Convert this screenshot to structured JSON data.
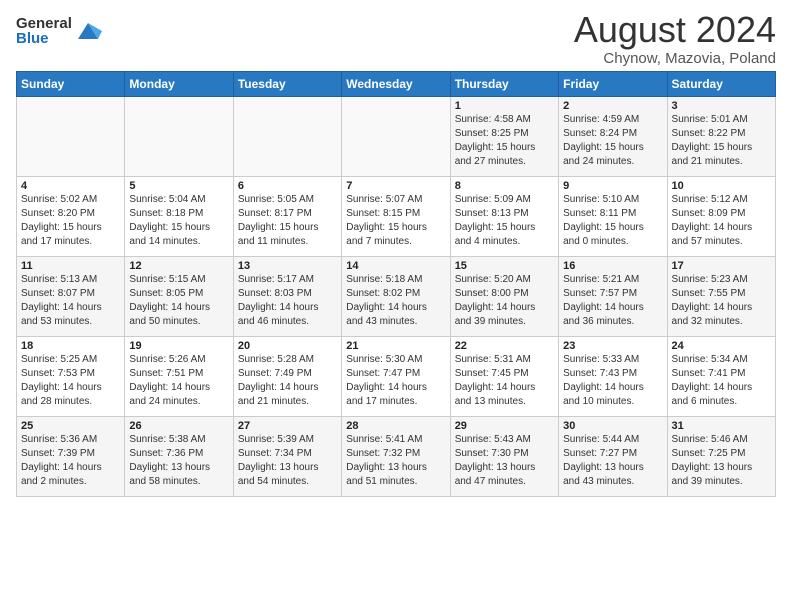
{
  "logo": {
    "general": "General",
    "blue": "Blue",
    "icon_color": "#2979c2"
  },
  "title": "August 2024",
  "location": "Chynow, Mazovia, Poland",
  "headers": [
    "Sunday",
    "Monday",
    "Tuesday",
    "Wednesday",
    "Thursday",
    "Friday",
    "Saturday"
  ],
  "rows": [
    [
      {
        "day": "",
        "info": ""
      },
      {
        "day": "",
        "info": ""
      },
      {
        "day": "",
        "info": ""
      },
      {
        "day": "",
        "info": ""
      },
      {
        "day": "1",
        "info": "Sunrise: 4:58 AM\nSunset: 8:25 PM\nDaylight: 15 hours\nand 27 minutes."
      },
      {
        "day": "2",
        "info": "Sunrise: 4:59 AM\nSunset: 8:24 PM\nDaylight: 15 hours\nand 24 minutes."
      },
      {
        "day": "3",
        "info": "Sunrise: 5:01 AM\nSunset: 8:22 PM\nDaylight: 15 hours\nand 21 minutes."
      }
    ],
    [
      {
        "day": "4",
        "info": "Sunrise: 5:02 AM\nSunset: 8:20 PM\nDaylight: 15 hours\nand 17 minutes."
      },
      {
        "day": "5",
        "info": "Sunrise: 5:04 AM\nSunset: 8:18 PM\nDaylight: 15 hours\nand 14 minutes."
      },
      {
        "day": "6",
        "info": "Sunrise: 5:05 AM\nSunset: 8:17 PM\nDaylight: 15 hours\nand 11 minutes."
      },
      {
        "day": "7",
        "info": "Sunrise: 5:07 AM\nSunset: 8:15 PM\nDaylight: 15 hours\nand 7 minutes."
      },
      {
        "day": "8",
        "info": "Sunrise: 5:09 AM\nSunset: 8:13 PM\nDaylight: 15 hours\nand 4 minutes."
      },
      {
        "day": "9",
        "info": "Sunrise: 5:10 AM\nSunset: 8:11 PM\nDaylight: 15 hours\nand 0 minutes."
      },
      {
        "day": "10",
        "info": "Sunrise: 5:12 AM\nSunset: 8:09 PM\nDaylight: 14 hours\nand 57 minutes."
      }
    ],
    [
      {
        "day": "11",
        "info": "Sunrise: 5:13 AM\nSunset: 8:07 PM\nDaylight: 14 hours\nand 53 minutes."
      },
      {
        "day": "12",
        "info": "Sunrise: 5:15 AM\nSunset: 8:05 PM\nDaylight: 14 hours\nand 50 minutes."
      },
      {
        "day": "13",
        "info": "Sunrise: 5:17 AM\nSunset: 8:03 PM\nDaylight: 14 hours\nand 46 minutes."
      },
      {
        "day": "14",
        "info": "Sunrise: 5:18 AM\nSunset: 8:02 PM\nDaylight: 14 hours\nand 43 minutes."
      },
      {
        "day": "15",
        "info": "Sunrise: 5:20 AM\nSunset: 8:00 PM\nDaylight: 14 hours\nand 39 minutes."
      },
      {
        "day": "16",
        "info": "Sunrise: 5:21 AM\nSunset: 7:57 PM\nDaylight: 14 hours\nand 36 minutes."
      },
      {
        "day": "17",
        "info": "Sunrise: 5:23 AM\nSunset: 7:55 PM\nDaylight: 14 hours\nand 32 minutes."
      }
    ],
    [
      {
        "day": "18",
        "info": "Sunrise: 5:25 AM\nSunset: 7:53 PM\nDaylight: 14 hours\nand 28 minutes."
      },
      {
        "day": "19",
        "info": "Sunrise: 5:26 AM\nSunset: 7:51 PM\nDaylight: 14 hours\nand 24 minutes."
      },
      {
        "day": "20",
        "info": "Sunrise: 5:28 AM\nSunset: 7:49 PM\nDaylight: 14 hours\nand 21 minutes."
      },
      {
        "day": "21",
        "info": "Sunrise: 5:30 AM\nSunset: 7:47 PM\nDaylight: 14 hours\nand 17 minutes."
      },
      {
        "day": "22",
        "info": "Sunrise: 5:31 AM\nSunset: 7:45 PM\nDaylight: 14 hours\nand 13 minutes."
      },
      {
        "day": "23",
        "info": "Sunrise: 5:33 AM\nSunset: 7:43 PM\nDaylight: 14 hours\nand 10 minutes."
      },
      {
        "day": "24",
        "info": "Sunrise: 5:34 AM\nSunset: 7:41 PM\nDaylight: 14 hours\nand 6 minutes."
      }
    ],
    [
      {
        "day": "25",
        "info": "Sunrise: 5:36 AM\nSunset: 7:39 PM\nDaylight: 14 hours\nand 2 minutes."
      },
      {
        "day": "26",
        "info": "Sunrise: 5:38 AM\nSunset: 7:36 PM\nDaylight: 13 hours\nand 58 minutes."
      },
      {
        "day": "27",
        "info": "Sunrise: 5:39 AM\nSunset: 7:34 PM\nDaylight: 13 hours\nand 54 minutes."
      },
      {
        "day": "28",
        "info": "Sunrise: 5:41 AM\nSunset: 7:32 PM\nDaylight: 13 hours\nand 51 minutes."
      },
      {
        "day": "29",
        "info": "Sunrise: 5:43 AM\nSunset: 7:30 PM\nDaylight: 13 hours\nand 47 minutes."
      },
      {
        "day": "30",
        "info": "Sunrise: 5:44 AM\nSunset: 7:27 PM\nDaylight: 13 hours\nand 43 minutes."
      },
      {
        "day": "31",
        "info": "Sunrise: 5:46 AM\nSunset: 7:25 PM\nDaylight: 13 hours\nand 39 minutes."
      }
    ]
  ]
}
